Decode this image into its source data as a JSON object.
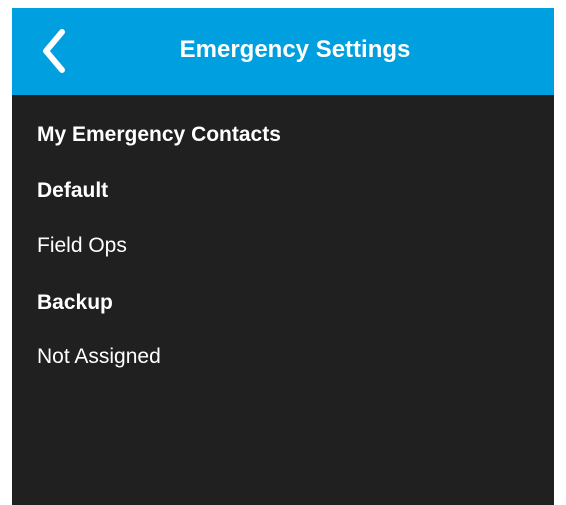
{
  "header": {
    "title": "Emergency Settings",
    "back_icon": "chevron-left-icon"
  },
  "content": {
    "section_title": "My Emergency Contacts",
    "default_label": "Default",
    "default_value": "Field Ops",
    "backup_label": "Backup",
    "backup_value": "Not Assigned"
  },
  "colors": {
    "header_bg": "#009fe0",
    "body_bg": "#202020",
    "text": "#ffffff"
  }
}
